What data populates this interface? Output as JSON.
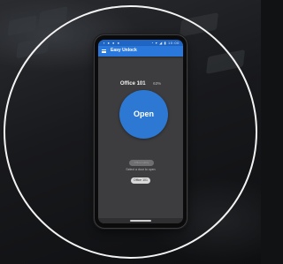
{
  "app": {
    "title": "Easy Unlock",
    "menu_icon": "hamburger-menu-icon"
  },
  "status_bar": {
    "left_icons": "▪ ● ● ●",
    "right_icons": "◔ ▾ ◢ ▮ 10:00"
  },
  "door": {
    "name": "Office 101",
    "battery": "63%"
  },
  "open_button": {
    "label": "Open"
  },
  "door_selector": {
    "disabled_label": "Office Lobby",
    "prompt": "Select a door to open",
    "selected_door": "Office 101"
  },
  "colors": {
    "status_bar": "#1f66c4",
    "app_bar": "#2a78db",
    "open_button": "#2d78d2",
    "screen_bg": "#3d3d3f",
    "ring": "#f4f4f4"
  }
}
